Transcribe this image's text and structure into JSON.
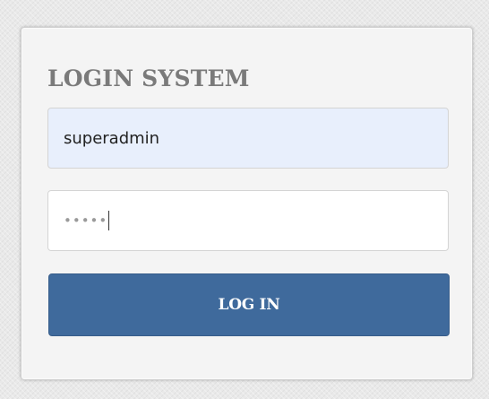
{
  "login": {
    "title": "LOGIN SYSTEM",
    "username": {
      "value": "superadmin"
    },
    "password": {
      "masked_value": "•••••"
    },
    "submit_label": "LOG IN"
  },
  "colors": {
    "button": "#3f6a9c",
    "title_text": "#7a7a7a",
    "autofill_background": "#e8effc"
  }
}
